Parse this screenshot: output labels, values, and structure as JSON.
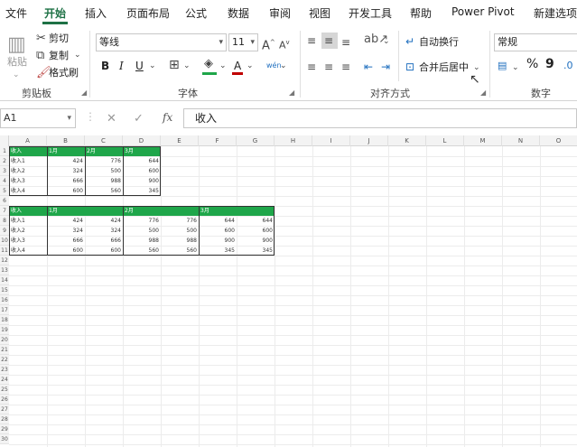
{
  "menu": {
    "tabs": [
      "文件",
      "开始",
      "插入",
      "页面布局",
      "公式",
      "数据",
      "审阅",
      "视图",
      "开发工具",
      "帮助",
      "Power Pivot",
      "新建选项卡"
    ],
    "active_index": 1
  },
  "ribbon": {
    "clipboard": {
      "paste": "粘贴",
      "cut": "剪切",
      "copy": "复制",
      "format_painter": "格式刷",
      "label": "剪贴板"
    },
    "font": {
      "font_name": "等线",
      "font_size": "11",
      "bold": "B",
      "italic": "I",
      "underline": "U",
      "grow": "A",
      "shrink": "A",
      "color_a": "A",
      "phonetic": "wén",
      "label": "字体"
    },
    "alignment": {
      "wrap_text": "自动换行",
      "merge_center": "合并后居中",
      "label": "对齐方式"
    },
    "number": {
      "format": "常规",
      "percent": "%",
      "comma": "9",
      "label": "数字"
    }
  },
  "formula_bar": {
    "name_box": "A1",
    "fx": "fx",
    "formula": "收入"
  },
  "grid": {
    "columns": [
      "A",
      "B",
      "C",
      "D",
      "E",
      "F",
      "G",
      "H",
      "I",
      "J",
      "K",
      "L",
      "M",
      "N",
      "O"
    ],
    "rows": [
      "1",
      "2",
      "3",
      "4",
      "5",
      "6",
      "7",
      "8",
      "9",
      "10",
      "11",
      "12",
      "13",
      "14",
      "15",
      "16",
      "17",
      "18",
      "19",
      "20",
      "21",
      "22",
      "23",
      "24",
      "25",
      "26",
      "27",
      "28",
      "29",
      "30"
    ],
    "table1": {
      "headers": [
        "收入",
        "1月",
        "2月",
        "3月"
      ],
      "rows": [
        [
          "收入1",
          "424",
          "776",
          "644"
        ],
        [
          "收入2",
          "324",
          "500",
          "600"
        ],
        [
          "收入3",
          "666",
          "988",
          "900"
        ],
        [
          "收入4",
          "600",
          "560",
          "345"
        ]
      ]
    },
    "table2": {
      "headers": [
        "收入",
        "1月",
        "",
        "2月",
        "",
        "3月",
        ""
      ],
      "rows": [
        [
          "收入1",
          "424",
          "424",
          "776",
          "776",
          "644",
          "644"
        ],
        [
          "收入2",
          "324",
          "324",
          "500",
          "500",
          "600",
          "600"
        ],
        [
          "收入3",
          "666",
          "666",
          "988",
          "988",
          "900",
          "900"
        ],
        [
          "收入4",
          "600",
          "600",
          "560",
          "560",
          "345",
          "345"
        ]
      ]
    }
  },
  "colors": {
    "accent": "#1e7145",
    "header_fill": "#1fa64a"
  }
}
